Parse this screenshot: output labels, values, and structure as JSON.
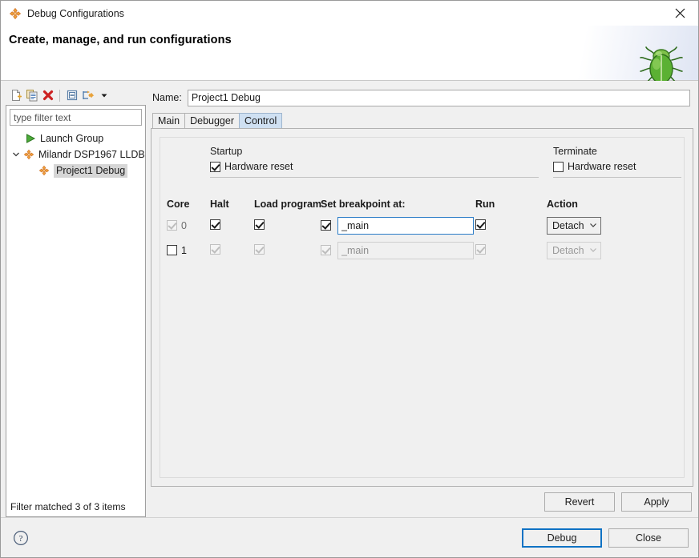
{
  "window": {
    "title": "Debug Configurations",
    "title_icon": "debug-config-icon",
    "close_icon": "close-icon"
  },
  "header": {
    "title": "Create, manage, and run configurations",
    "decoration_icon": "green-bug-icon"
  },
  "tree_panel": {
    "toolbar": [
      {
        "name": "new-configuration-icon",
        "tooltip": "New launch configuration"
      },
      {
        "name": "duplicate-configuration-icon",
        "tooltip": "Duplicate"
      },
      {
        "name": "delete-configuration-icon",
        "tooltip": "Delete"
      },
      {
        "name": "collapse-all-icon",
        "tooltip": "Collapse All"
      },
      {
        "name": "filter-launch-configurations-icon",
        "tooltip": "Filter"
      },
      {
        "name": "view-menu-chevron-icon",
        "tooltip": "View Menu"
      }
    ],
    "filter": {
      "placeholder": "type filter text",
      "value": ""
    },
    "items": [
      {
        "label": "Launch Group",
        "icon": "launch-group-icon",
        "indent": 1,
        "twisty": "",
        "selected": false
      },
      {
        "label": "Milandr DSP1967 LLDB",
        "icon": "debug-config-icon",
        "indent": 0,
        "twisty": "expanded",
        "selected": false
      },
      {
        "label": "Project1 Debug",
        "icon": "debug-config-icon",
        "indent": 2,
        "twisty": "",
        "selected": true
      }
    ],
    "status": "Filter matched 3 of 3 items"
  },
  "config": {
    "name_label": "Name:",
    "name_value": "Project1 Debug",
    "tabs": [
      {
        "label": "Main",
        "active": false
      },
      {
        "label": "Debugger",
        "active": false
      },
      {
        "label": "Control",
        "active": true
      }
    ],
    "startup": {
      "title": "Startup",
      "hardware_reset_label": "Hardware reset",
      "hardware_reset_checked": true
    },
    "terminate": {
      "title": "Terminate",
      "hardware_reset_label": "Hardware reset",
      "hardware_reset_checked": false
    },
    "grid": {
      "headers": {
        "core": "Core",
        "halt": "Halt",
        "load_program": "Load program",
        "breakpoint": "Set breakpoint at:",
        "run": "Run",
        "action": "Action"
      },
      "rows": [
        {
          "core_number": "0",
          "core_checked": true,
          "core_enabled": false,
          "halt_checked": true,
          "halt_enabled": true,
          "load_checked": true,
          "load_enabled": true,
          "bp_checked": true,
          "bp_enabled": true,
          "bp_value": "_main",
          "run_checked": true,
          "run_enabled": true,
          "action_value": "Detach",
          "action_enabled": true
        },
        {
          "core_number": "1",
          "core_checked": false,
          "core_enabled": true,
          "halt_checked": true,
          "halt_enabled": false,
          "load_checked": true,
          "load_enabled": false,
          "bp_checked": true,
          "bp_enabled": false,
          "bp_value": "_main",
          "run_checked": true,
          "run_enabled": false,
          "action_value": "Detach",
          "action_enabled": false
        }
      ]
    },
    "revert_label": "Revert",
    "apply_label": "Apply"
  },
  "footer": {
    "help_icon": "help-question-icon",
    "debug_label": "Debug",
    "close_label": "Close"
  },
  "colors": {
    "accent": "#0f72c4",
    "tab_active": "#cfe0f2",
    "focus_border": "#2a7cc7",
    "bug_green": "#4ea02c",
    "delete_red": "#cc2222",
    "config_orange": "#e98b2c"
  }
}
